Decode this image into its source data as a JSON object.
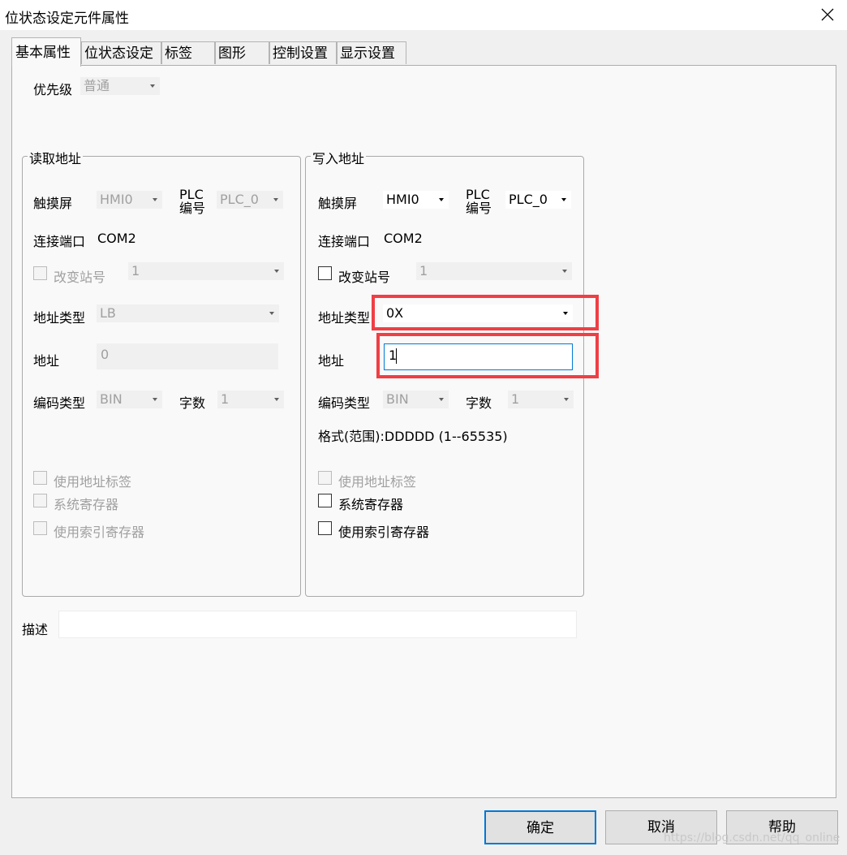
{
  "window": {
    "title": "位状态设定元件属性",
    "close_icon": "close-icon"
  },
  "tabs": [
    {
      "label": "基本属性",
      "active": true
    },
    {
      "label": "位状态设定",
      "active": false
    },
    {
      "label": "标签",
      "active": false
    },
    {
      "label": "图形",
      "active": false
    },
    {
      "label": "控制设置",
      "active": false
    },
    {
      "label": "显示设置",
      "active": false
    }
  ],
  "priority": {
    "label": "优先级",
    "value": "普通"
  },
  "read_group": {
    "title": "读取地址",
    "touchscreen_label": "触摸屏",
    "touchscreen_value": "HMI0",
    "plc_label_1": "PLC",
    "plc_label_2": "编号",
    "plc_value": "PLC_0",
    "port_label": "连接端口",
    "port_value": "COM2",
    "change_station_label": "改变站号",
    "change_station_value": "1",
    "addr_type_label": "地址类型",
    "addr_type_value": "LB",
    "addr_label": "地址",
    "addr_value": "0",
    "encoding_label": "编码类型",
    "encoding_value": "BIN",
    "word_count_label": "字数",
    "word_count_value": "1",
    "use_addr_tag_label": "使用地址标签",
    "system_register_label": "系统寄存器",
    "use_index_register_label": "使用索引寄存器"
  },
  "write_group": {
    "title": "写入地址",
    "touchscreen_label": "触摸屏",
    "touchscreen_value": "HMI0",
    "plc_label_1": "PLC",
    "plc_label_2": "编号",
    "plc_value": "PLC_0",
    "port_label": "连接端口",
    "port_value": "COM2",
    "change_station_label": "改变站号",
    "change_station_value": "1",
    "addr_type_label": "地址类型",
    "addr_type_value": "0X",
    "addr_label": "地址",
    "addr_value": "1",
    "encoding_label": "编码类型",
    "encoding_value": "BIN",
    "word_count_label": "字数",
    "word_count_value": "1",
    "format_text": "格式(范围):DDDDD (1--65535)",
    "use_addr_tag_label": "使用地址标签",
    "system_register_label": "系统寄存器",
    "use_index_register_label": "使用索引寄存器"
  },
  "description": {
    "label": "描述",
    "value": ""
  },
  "buttons": {
    "ok": "确定",
    "cancel": "取消",
    "help": "帮助"
  },
  "watermark": "https://blog.csdn.net/qq_online",
  "colors": {
    "highlight": "#ef3f45",
    "focus": "#0078d7",
    "panel": "#f9f9f9",
    "disabled_text": "#a0a0a0"
  }
}
